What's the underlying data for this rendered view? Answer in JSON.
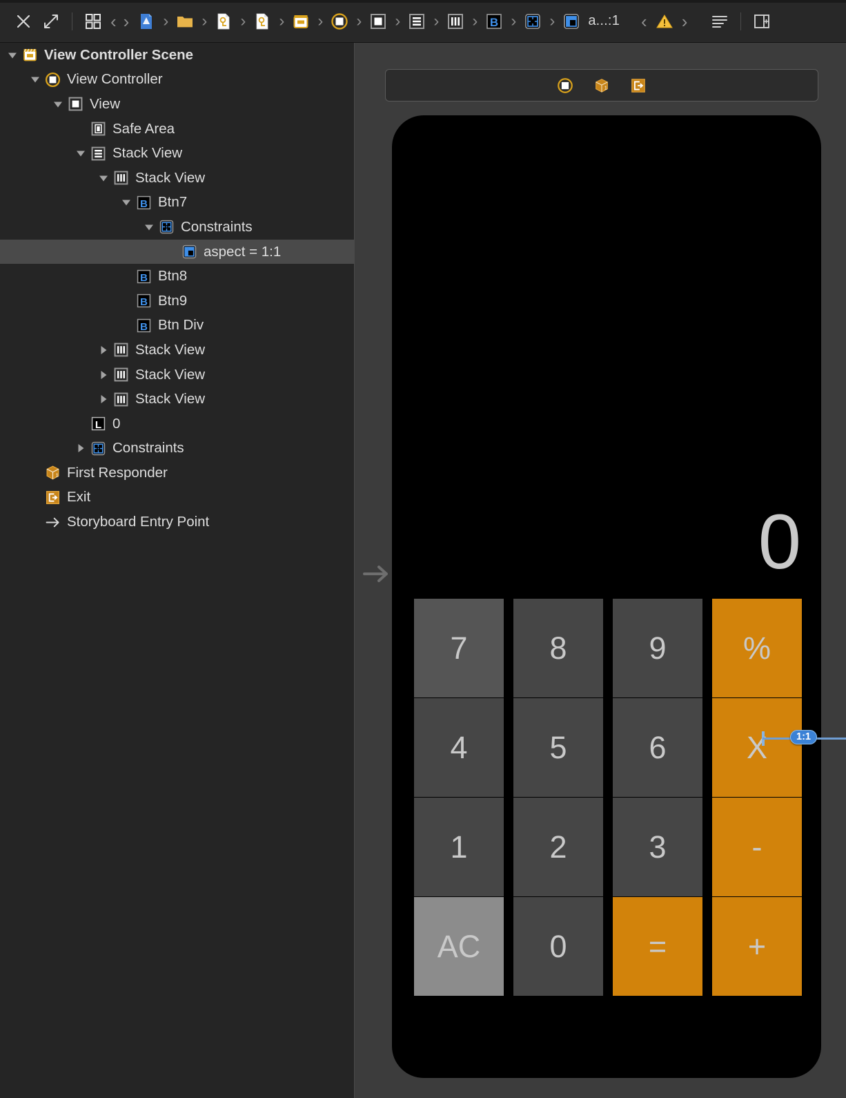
{
  "toolbar": {
    "left_buttons": [
      {
        "name": "close-icon",
        "label": "✕"
      },
      {
        "name": "expand-icon",
        "label": "⤢"
      }
    ],
    "grid_button": {
      "name": "assistant-grid-icon",
      "label": "grid"
    },
    "back_label": "‹",
    "forward_label": "›",
    "jump_bar": [
      {
        "name": "project-icon",
        "label": "Project"
      },
      {
        "name": "folder-icon",
        "label": "Folder"
      },
      {
        "name": "storyboard-file-icon",
        "label": "Main.storyboard"
      },
      {
        "name": "storyboard-file-icon-2",
        "label": "Main.storyboard"
      },
      {
        "name": "scene-icon",
        "label": "View Controller Scene"
      },
      {
        "name": "view-controller-icon",
        "label": "View Controller"
      },
      {
        "name": "view-icon",
        "label": "View"
      },
      {
        "name": "stack-view-vertical-icon",
        "label": "Stack View"
      },
      {
        "name": "stack-view-horizontal-icon",
        "label": "Stack View"
      },
      {
        "name": "button-icon",
        "label": "Btn7"
      },
      {
        "name": "constraints-icon",
        "label": "Constraints"
      },
      {
        "name": "aspect-constraint-icon",
        "label": "aspect"
      }
    ],
    "current_item": "a...:1",
    "issue_prev": "‹",
    "issue_next": "›",
    "warning_icon": "warning-triangle-icon",
    "editor_options_icon": "editor-options-icon",
    "inspector_toggle_icon": "inspector-toggle-icon"
  },
  "outline": {
    "rows": [
      {
        "label": "View Controller Scene",
        "icon": "scene-icon",
        "indent": 0,
        "disclosure": "open",
        "bold": true,
        "selected": false
      },
      {
        "label": "View Controller",
        "icon": "view-controller-icon",
        "indent": 1,
        "disclosure": "open",
        "bold": false,
        "selected": false
      },
      {
        "label": "View",
        "icon": "view-icon",
        "indent": 2,
        "disclosure": "open",
        "bold": false,
        "selected": false
      },
      {
        "label": "Safe Area",
        "icon": "safe-area-icon",
        "indent": 3,
        "disclosure": "none",
        "bold": false,
        "selected": false
      },
      {
        "label": "Stack View",
        "icon": "stack-vertical-icon",
        "indent": 3,
        "disclosure": "open",
        "bold": false,
        "selected": false
      },
      {
        "label": "Stack View",
        "icon": "stack-horizontal-icon",
        "indent": 4,
        "disclosure": "open",
        "bold": false,
        "selected": false
      },
      {
        "label": "Btn7",
        "icon": "button-icon",
        "indent": 5,
        "disclosure": "open",
        "bold": false,
        "selected": false
      },
      {
        "label": "Constraints",
        "icon": "constraints-icon",
        "indent": 6,
        "disclosure": "open",
        "bold": false,
        "selected": false
      },
      {
        "label": "aspect = 1:1",
        "icon": "aspect-icon",
        "indent": 7,
        "disclosure": "none",
        "bold": false,
        "selected": true
      },
      {
        "label": "Btn8",
        "icon": "button-icon",
        "indent": 5,
        "disclosure": "none",
        "bold": false,
        "selected": false
      },
      {
        "label": "Btn9",
        "icon": "button-icon",
        "indent": 5,
        "disclosure": "none",
        "bold": false,
        "selected": false
      },
      {
        "label": "Btn Div",
        "icon": "button-icon",
        "indent": 5,
        "disclosure": "none",
        "bold": false,
        "selected": false
      },
      {
        "label": "Stack View",
        "icon": "stack-horizontal-icon",
        "indent": 4,
        "disclosure": "closed",
        "bold": false,
        "selected": false
      },
      {
        "label": "Stack View",
        "icon": "stack-horizontal-icon",
        "indent": 4,
        "disclosure": "closed",
        "bold": false,
        "selected": false
      },
      {
        "label": "Stack View",
        "icon": "stack-horizontal-icon",
        "indent": 4,
        "disclosure": "closed",
        "bold": false,
        "selected": false
      },
      {
        "label": "0",
        "icon": "label-icon",
        "indent": 3,
        "disclosure": "none",
        "bold": false,
        "selected": false
      },
      {
        "label": "Constraints",
        "icon": "constraints-icon",
        "indent": 3,
        "disclosure": "closed",
        "bold": false,
        "selected": false
      },
      {
        "label": "First Responder",
        "icon": "first-responder-icon",
        "indent": 1,
        "disclosure": "none",
        "bold": false,
        "selected": false
      },
      {
        "label": "Exit",
        "icon": "exit-icon",
        "indent": 1,
        "disclosure": "none",
        "bold": false,
        "selected": false
      },
      {
        "label": "Storyboard Entry Point",
        "icon": "entry-point-arrow-icon",
        "indent": 1,
        "disclosure": "none",
        "bold": false,
        "selected": false
      }
    ]
  },
  "canvas": {
    "scene_bar_icons": [
      {
        "name": "view-controller-icon",
        "label": "View Controller"
      },
      {
        "name": "first-responder-icon",
        "label": "First Responder"
      },
      {
        "name": "exit-icon",
        "label": "Exit"
      }
    ],
    "entry_point_icon": "storyboard-entry-arrow-icon",
    "display_value": "0",
    "keypad": {
      "rows": [
        [
          {
            "label": "7",
            "style": "num-light"
          },
          {
            "label": "8",
            "style": "num"
          },
          {
            "label": "9",
            "style": "num"
          },
          {
            "label": "%",
            "style": "op"
          }
        ],
        [
          {
            "label": "4",
            "style": "num"
          },
          {
            "label": "5",
            "style": "num"
          },
          {
            "label": "6",
            "style": "num"
          },
          {
            "label": "X",
            "style": "op"
          }
        ],
        [
          {
            "label": "1",
            "style": "num"
          },
          {
            "label": "2",
            "style": "num"
          },
          {
            "label": "3",
            "style": "num"
          },
          {
            "label": "-",
            "style": "op"
          }
        ],
        [
          {
            "label": "AC",
            "style": "ac"
          },
          {
            "label": "0",
            "style": "num"
          },
          {
            "label": "=",
            "style": "op"
          },
          {
            "label": "+",
            "style": "op"
          }
        ]
      ]
    },
    "constraints": [
      {
        "name": "aspect-constraint-btn8",
        "label": "1:1",
        "orientation": "vertical"
      },
      {
        "name": "aspect-constraint-btn4",
        "label": "1:1",
        "orientation": "horizontal"
      }
    ]
  },
  "colors": {
    "accent_orange": "#d2830b",
    "key_gray": "#464646",
    "key_gray_light": "#555555",
    "ac_gray": "#8c8c8c",
    "constraint_blue": "#3b82d6",
    "selection_gray": "#4a4a4a",
    "panel_bg": "#252525",
    "canvas_bg": "#3c3c3c"
  }
}
